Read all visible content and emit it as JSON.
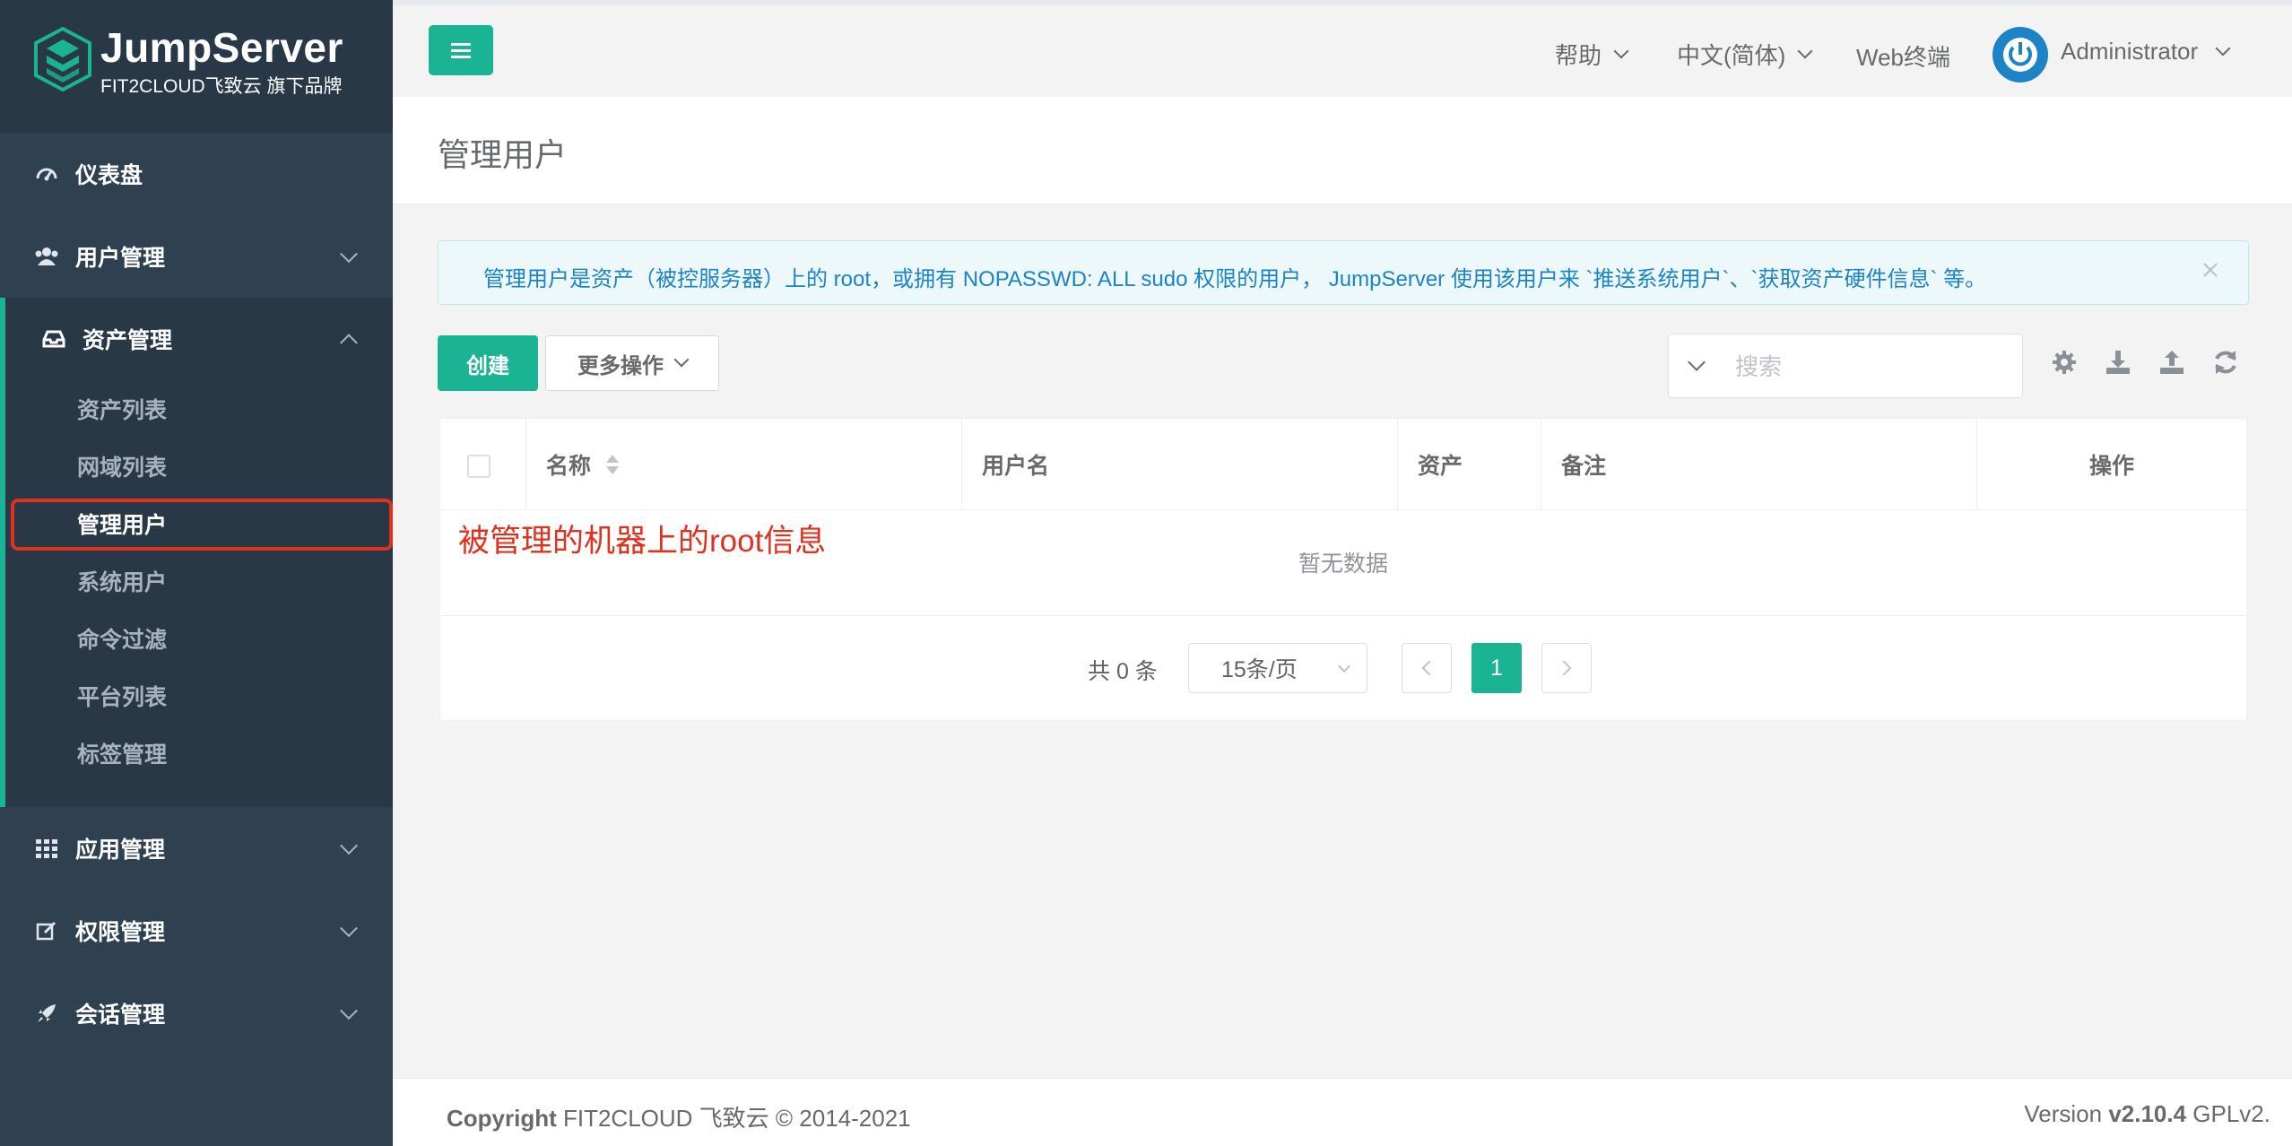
{
  "brand": {
    "title": "JumpServer",
    "subtitle": "FIT2CLOUD飞致云 旗下品牌"
  },
  "sidebar": {
    "items": [
      {
        "label": "仪表盘",
        "icon": "dashboard-icon"
      },
      {
        "label": "用户管理",
        "icon": "users-icon"
      },
      {
        "label": "资产管理",
        "icon": "inbox-icon",
        "expanded": true
      },
      {
        "label": "应用管理",
        "icon": "grid-icon"
      },
      {
        "label": "权限管理",
        "icon": "edit-icon"
      },
      {
        "label": "会话管理",
        "icon": "rocket-icon"
      }
    ],
    "asset_submenu": [
      "资产列表",
      "网域列表",
      "管理用户",
      "系统用户",
      "命令过滤",
      "平台列表",
      "标签管理"
    ],
    "current": "管理用户"
  },
  "topbar": {
    "help": "帮助",
    "language": "中文(简体)",
    "web_terminal": "Web终端",
    "user": "Administrator"
  },
  "page": {
    "title": "管理用户"
  },
  "alert": {
    "text": "管理用户是资产（被控服务器）上的 root，或拥有 NOPASSWD: ALL sudo 权限的用户， JumpServer 使用该用户来 `推送系统用户`、`获取资产硬件信息` 等。"
  },
  "toolbar": {
    "create_label": "创建",
    "more_label": "更多操作",
    "search_placeholder": "搜索"
  },
  "table": {
    "columns": [
      "名称",
      "用户名",
      "资产",
      "备注",
      "操作"
    ],
    "empty_text": "暂无数据",
    "annotation": "被管理的机器上的root信息"
  },
  "pagination": {
    "total_text": "共 0 条",
    "page_size": "15条/页",
    "current_page": "1"
  },
  "footer": {
    "copyright_bold": "Copyright",
    "copyright_rest": " FIT2CLOUD 飞致云 © 2014-2021",
    "version_prefix": "Version ",
    "version": "v2.10.4",
    "license": " GPLv2."
  },
  "colors": {
    "accent": "#1ab394",
    "sidebar": "#2f4050",
    "annotation": "#e0301e",
    "info": "#1c84c6"
  }
}
